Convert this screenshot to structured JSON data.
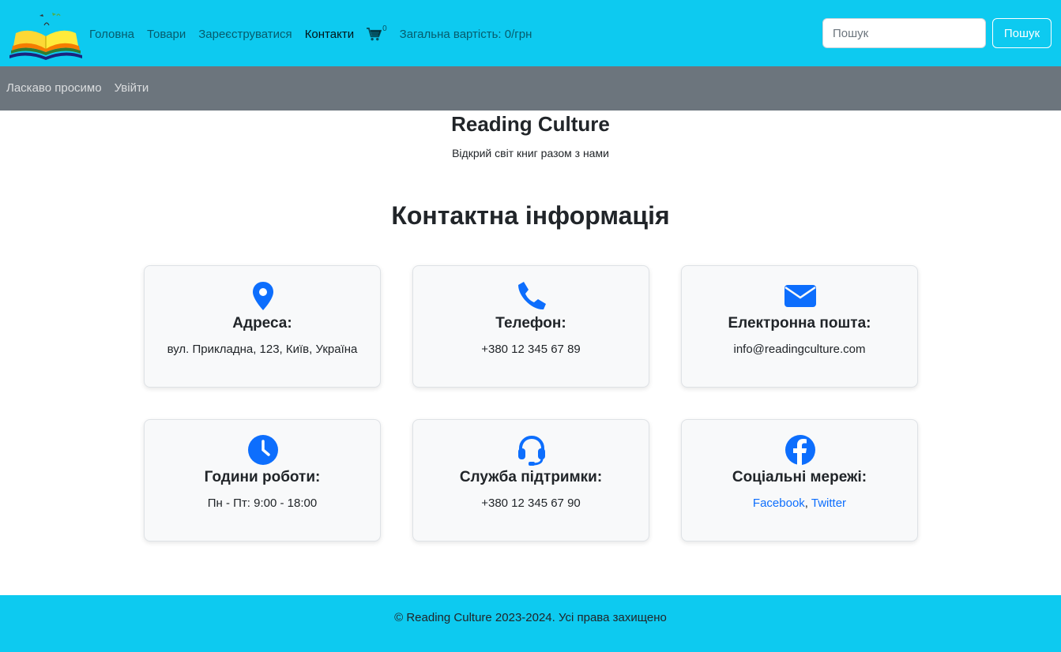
{
  "navbar": {
    "logo_icon": "open-book-logo",
    "links": [
      {
        "label": "Головна"
      },
      {
        "label": "Товари"
      },
      {
        "label": "Зареєструватися"
      },
      {
        "label": "Контакти",
        "active": true
      }
    ],
    "cart_icon": "shopping-cart-icon",
    "cart_count": "0",
    "total_text": "Загальна вартість: 0/грн",
    "search_placeholder": "Пошук",
    "search_button": "Пошук",
    "background_color": "#0dcaf0"
  },
  "subnav": {
    "items": [
      "Ласкаво просимо",
      "Увійти"
    ],
    "background_color": "#6c757d"
  },
  "hero": {
    "title": "Reading Culture",
    "tagline": "Відкрий світ книг разом з нами"
  },
  "contact_section": {
    "heading": "Контактна інформація",
    "accent_color": "#0d6efd",
    "cards": [
      {
        "icon": "map-pin-icon",
        "title": "Адреса:",
        "value": "вул. Прикладна, 123, Київ, Україна"
      },
      {
        "icon": "phone-icon",
        "title": "Телефон:",
        "value": "+380 12 345 67 89"
      },
      {
        "icon": "envelope-icon",
        "title": "Електронна пошта:",
        "value": "info@readingculture.com"
      },
      {
        "icon": "clock-icon",
        "title": "Години роботи:",
        "value": "Пн - Пт: 9:00 - 18:00"
      },
      {
        "icon": "headset-icon",
        "title": "Служба підтримки:",
        "value": "+380 12 345 67 90"
      },
      {
        "icon": "facebook-icon",
        "title": "Соціальні мережі:",
        "links": [
          "Facebook",
          "Twitter"
        ],
        "separator": ", "
      }
    ]
  },
  "footer": {
    "text": "© Reading Culture 2023-2024. Усі права захищено"
  }
}
